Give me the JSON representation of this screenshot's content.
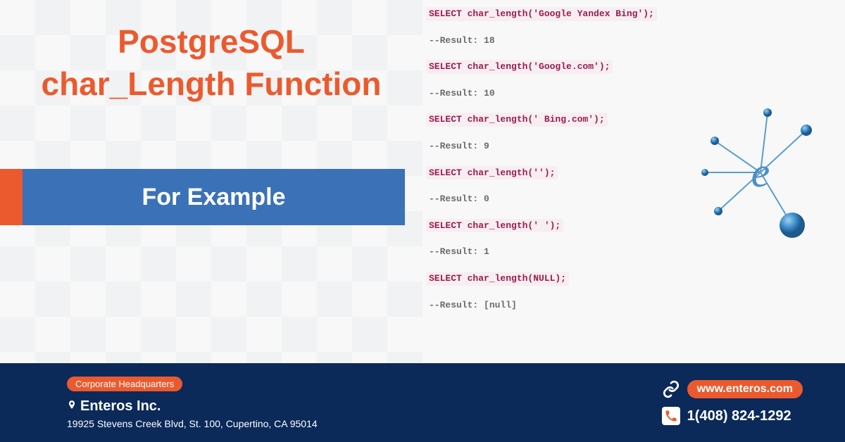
{
  "title": {
    "line1": "PostgreSQL",
    "line2": "char_Length Function"
  },
  "banner": {
    "label": "For Example"
  },
  "code": {
    "lines": [
      {
        "type": "query",
        "text": "SELECT char_length('Google Yandex Bing');"
      },
      {
        "type": "result",
        "text": "--Result: 18"
      },
      {
        "type": "query",
        "text": "SELECT char_length('Google.com');"
      },
      {
        "type": "result",
        "text": "--Result: 10"
      },
      {
        "type": "query",
        "text": "SELECT char_length(' Bing.com');"
      },
      {
        "type": "result",
        "text": "--Result: 9"
      },
      {
        "type": "query",
        "text": "SELECT char_length('');"
      },
      {
        "type": "result",
        "text": "--Result: 0"
      },
      {
        "type": "query",
        "text": "SELECT char_length(' ');"
      },
      {
        "type": "result",
        "text": "--Result: 1"
      },
      {
        "type": "query",
        "text": "SELECT char_length(NULL);"
      },
      {
        "type": "result",
        "text": "--Result: [null]"
      }
    ]
  },
  "footer": {
    "badge": "Corporate Headquarters",
    "company": "Enteros Inc.",
    "address": "19925 Stevens Creek Blvd, St. 100, Cupertino, CA 95014",
    "website": "www.enteros.com",
    "phone": "1(408) 824-1292"
  },
  "colors": {
    "accent": "#eb5a2e",
    "blue": "#3b71b7",
    "navy": "#0b2a5a",
    "code_bg": "#f7eef1",
    "code_fg": "#9a1d4f"
  }
}
